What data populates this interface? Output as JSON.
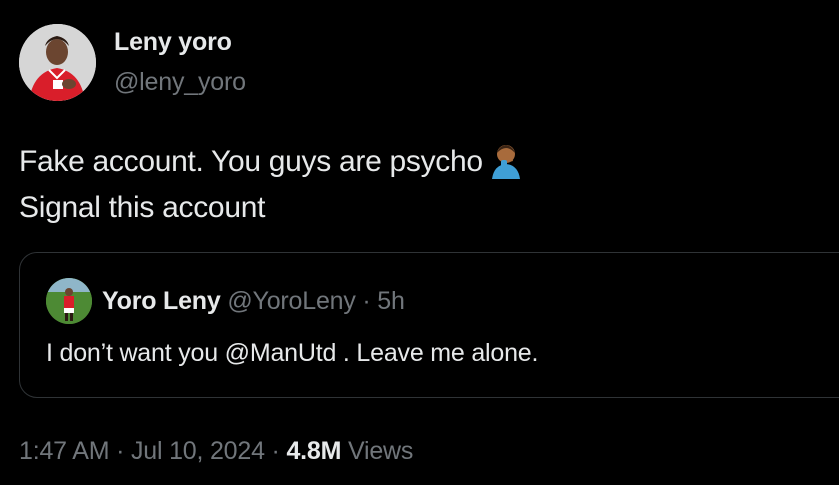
{
  "author": {
    "display_name": "Leny yoro",
    "handle": "@leny_yoro"
  },
  "tweet": {
    "line1": "Fake account. You guys are psycho",
    "emoji": "facepalm-emoji",
    "line2": "Signal this account"
  },
  "quoted_tweet": {
    "display_name": "Yoro Leny",
    "handle": "@YoroLeny",
    "separator": "·",
    "time": "5h",
    "text": "I don’t want you @ManUtd . Leave me alone."
  },
  "meta": {
    "time": "1:47 AM",
    "separator1": "·",
    "date": "Jul 10, 2024",
    "separator2": "·",
    "views_count": "4.8M",
    "views_label": "Views"
  },
  "colors": {
    "background": "#000000",
    "primary_text": "#e7e9ea",
    "secondary_text": "#71767b",
    "border": "#2f3336"
  }
}
